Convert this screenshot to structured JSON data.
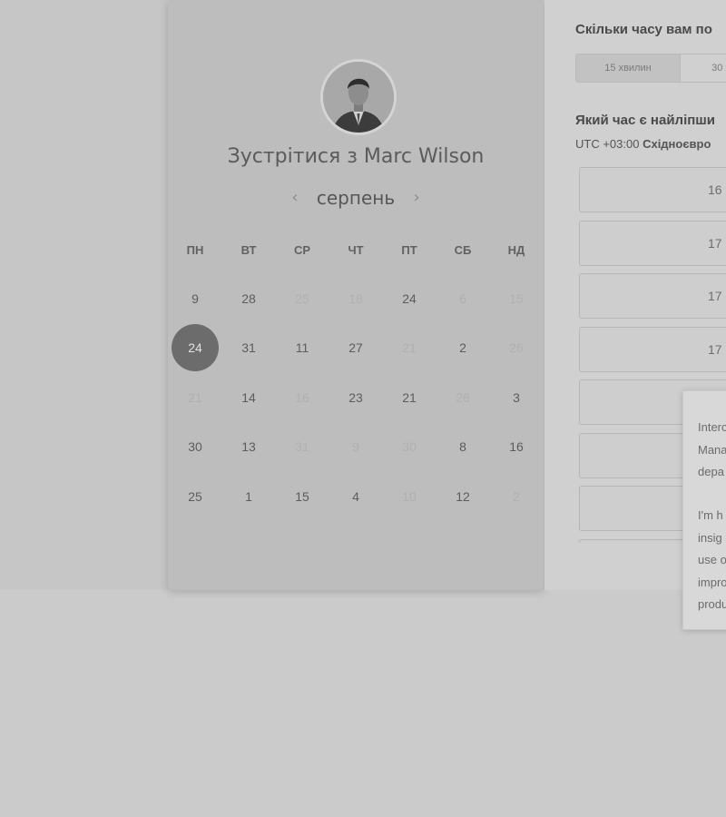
{
  "meeting": {
    "title": "Зустрітися з Marc Wilson",
    "month": "серпень",
    "prev_arrow": "‹",
    "next_arrow": "›"
  },
  "calendar": {
    "weekdays": [
      "ПН",
      "ВТ",
      "СР",
      "ЧТ",
      "ПТ",
      "СБ",
      "НД"
    ],
    "weeks": [
      [
        {
          "d": "9",
          "m": false
        },
        {
          "d": "28",
          "m": false
        },
        {
          "d": "25",
          "m": true
        },
        {
          "d": "18",
          "m": true
        },
        {
          "d": "24",
          "m": false
        },
        {
          "d": "6",
          "m": true
        },
        {
          "d": "15",
          "m": true
        }
      ],
      [
        {
          "d": "24",
          "m": false,
          "sel": true
        },
        {
          "d": "31",
          "m": false
        },
        {
          "d": "11",
          "m": false
        },
        {
          "d": "27",
          "m": false
        },
        {
          "d": "21",
          "m": true
        },
        {
          "d": "2",
          "m": false
        },
        {
          "d": "26",
          "m": true
        }
      ],
      [
        {
          "d": "21",
          "m": true
        },
        {
          "d": "14",
          "m": false
        },
        {
          "d": "16",
          "m": true
        },
        {
          "d": "23",
          "m": false
        },
        {
          "d": "21",
          "m": false
        },
        {
          "d": "26",
          "m": true
        },
        {
          "d": "3",
          "m": false
        }
      ],
      [
        {
          "d": "30",
          "m": false
        },
        {
          "d": "13",
          "m": false
        },
        {
          "d": "31",
          "m": true
        },
        {
          "d": "9",
          "m": true
        },
        {
          "d": "30",
          "m": true
        },
        {
          "d": "8",
          "m": false
        },
        {
          "d": "16",
          "m": false
        }
      ],
      [
        {
          "d": "25",
          "m": false
        },
        {
          "d": "1",
          "m": false
        },
        {
          "d": "15",
          "m": false
        },
        {
          "d": "4",
          "m": false
        },
        {
          "d": "10",
          "m": true
        },
        {
          "d": "12",
          "m": false
        },
        {
          "d": "2",
          "m": true
        }
      ]
    ]
  },
  "duration": {
    "question": "Скільки часу вам по",
    "options": [
      "15 хвилин",
      "30 х"
    ]
  },
  "time": {
    "question": "Який час є найліпши",
    "tz_offset": "UTC +03:00",
    "tz_name": "Східноєвро",
    "slots": [
      "16",
      "17",
      "17",
      "17",
      "",
      "",
      "",
      ""
    ]
  },
  "tooltip": {
    "lines_a": [
      "Interc",
      "Mana",
      "depa"
    ],
    "lines_b": [
      "I'm h",
      "insig",
      "use o",
      "impro",
      "produ"
    ]
  }
}
